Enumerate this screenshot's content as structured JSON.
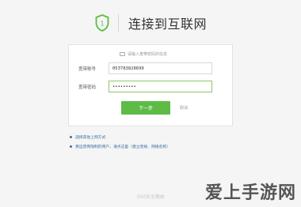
{
  "header": {
    "title": "连接到互联网"
  },
  "form": {
    "hint": "请输入宽带密码的信息",
    "account_label": "宽带账号",
    "account_value": "053783828699",
    "password_label": "宽带密码",
    "password_value": "•••••••••",
    "next_label": "下一步",
    "cancel_label": "取消"
  },
  "links": [
    "选择其他上网方式",
    "受运营商限制的用户，请点这里（建立连接、网络名称）"
  ],
  "footer": {
    "brand": "360安全路由"
  },
  "watermark": "爱上手游网",
  "colors": {
    "accent": "#5dbb46",
    "link": "#3a6ea5",
    "background": "#f4f5f4"
  }
}
